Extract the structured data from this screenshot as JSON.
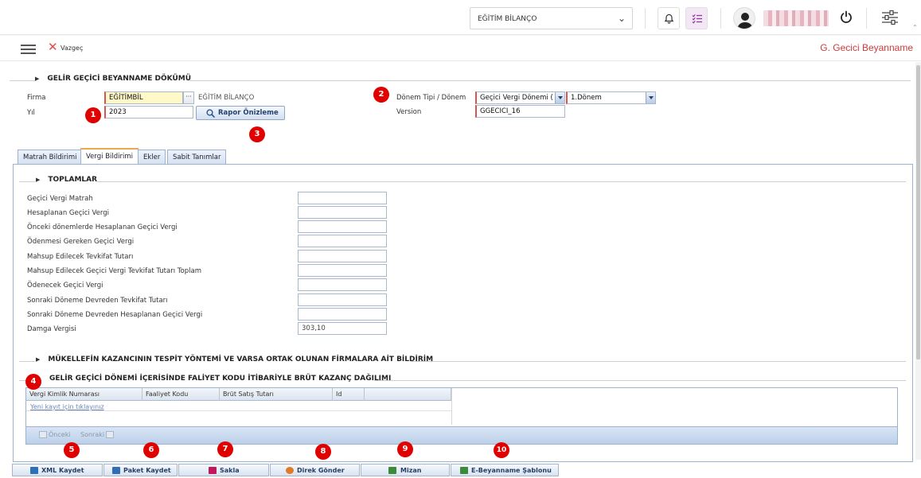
{
  "header": {
    "company_select": "EĞİTİM BİLANÇO",
    "icons": [
      "bell-icon",
      "tasks-icon",
      "user-icon",
      "power-icon",
      "settings-sliders-icon"
    ]
  },
  "actionbar": {
    "cancel_label": "Vazgeç",
    "page_title": "G. Gecici Beyanname"
  },
  "report": {
    "section_title": "GELİR GEÇİCİ BEYANNAME DÖKÜMÜ",
    "firma_label": "Firma",
    "firma_code": "EĞİTİMBİL",
    "firma_name": "EĞİTİM BİLANÇO",
    "yil_label": "Yıl",
    "yil_value": "2023",
    "preview_button": "Rapor Önizleme",
    "donem_label": "Dönem Tipi / Dönem",
    "donem_tipi": "Geçici Vergi Dönemi ( N",
    "donem": "1.Dönem",
    "version_label": "Version",
    "version_value": "GGECICI_16"
  },
  "tabs": [
    {
      "label": "Matrah Bildirimi"
    },
    {
      "label": "Vergi Bildirimi"
    },
    {
      "label": "Ekler"
    },
    {
      "label": "Sabit Tanımlar"
    }
  ],
  "totals": {
    "section_title": "TOPLAMLAR",
    "rows": [
      {
        "label": "Geçici Vergi Matrah",
        "value": ""
      },
      {
        "label": "Hesaplanan Geçici Vergi",
        "value": ""
      },
      {
        "label": "Önceki dönemlerde Hesaplanan Geçici Vergi",
        "value": ""
      },
      {
        "label": "Ödenmesi Gereken Geçici Vergi",
        "value": ""
      },
      {
        "label": "Mahsup Edilecek Tevkifat Tutarı",
        "value": ""
      },
      {
        "label": "Mahsup Edilecek Geçici Vergi Tevkifat Tutarı Toplam",
        "value": ""
      },
      {
        "label": "Ödenecek Geçici Vergi",
        "value": ""
      },
      {
        "label": "Sonraki Döneme Devreden Tevkifat Tutarı",
        "value": ""
      },
      {
        "label": "Sonraki Döneme Devreden Hesaplanan Geçici Vergi",
        "value": ""
      },
      {
        "label": "Damga Vergisi",
        "value": "303,10"
      }
    ]
  },
  "section2_title": "MÜKELLEFİN KAZANCININ TESPİT YÖNTEMİ VE VARSA ORTAK OLUNAN FİRMALARA AİT BİLDİRİM",
  "section3_title": "GELİR GEÇİCİ DÖNEMİ İÇERİSİNDE FALİYET KODU İTİBARİYLE BRÜT KAZANÇ DAĞILIMI",
  "grid": {
    "columns": [
      "Vergi Kimlik Numarası",
      "Faaliyet Kodu",
      "Brüt Satış Tutarı",
      "Id"
    ],
    "new_row_link": "Yeni kayıt için tıklayınız",
    "prev_label": "Önceki",
    "next_label": "Sonraki"
  },
  "bottom_buttons": [
    {
      "label": "XML Kaydet",
      "icon": "save-icon",
      "color": "#2f6fb5"
    },
    {
      "label": "Paket Kaydet",
      "icon": "save-icon",
      "color": "#2f6fb5"
    },
    {
      "label": "Sakla",
      "icon": "floppy-icon",
      "color": "#c2185b"
    },
    {
      "label": "Direk Gönder",
      "icon": "send-icon",
      "color": "#e07b24"
    },
    {
      "label": "Mizan",
      "icon": "balance-icon",
      "color": "#3a8b3a"
    },
    {
      "label": "E-Beyanname Şablonu",
      "icon": "template-icon",
      "color": "#3a8b3a"
    }
  ],
  "badges": [
    "1",
    "2",
    "3",
    "4",
    "5",
    "6",
    "7",
    "8",
    "9",
    "10"
  ]
}
